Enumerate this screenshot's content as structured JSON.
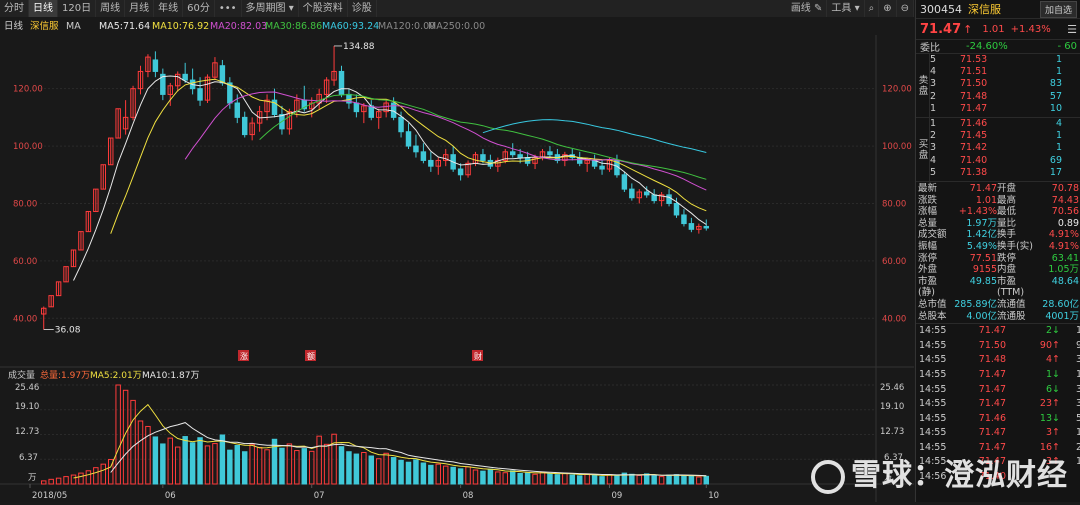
{
  "toolbar": {
    "tabs": [
      "分时",
      "日线",
      "120日",
      "周线",
      "月线",
      "年线",
      "60分"
    ],
    "active_tab": 1,
    "more": "•••",
    "multi_period": "多周期图",
    "stock_info": "个股资料",
    "diagnosis": "诊股",
    "draw": "画线",
    "tools": "工具"
  },
  "chart_header": {
    "period": "日线",
    "stock": "深信服",
    "ma_label": "MA",
    "ma5": "MA5:71.64",
    "ma10": "MA10:76.92",
    "ma20": "MA20:82.03",
    "ma30": "MA30:86.86",
    "ma60": "MA60:93.24",
    "ma120": "MA120:0.00",
    "ma250": "MA250:0.00"
  },
  "colors": {
    "ma5": "#e8e8e8",
    "ma10": "#f0e040",
    "ma20": "#d050d0",
    "ma30": "#40c040",
    "ma60": "#38c8e0",
    "up": "#ff3b3b",
    "down": "#40c8d8"
  },
  "annotations": {
    "high": "134.88",
    "low": "36.08",
    "mark1": "涨",
    "mark2": "额",
    "mark3": "财"
  },
  "volume_header": {
    "title": "成交量",
    "total": "总量:1.97万",
    "ma5": "MA5:2.01万",
    "ma10": "MA10:1.87万"
  },
  "volume_axis": {
    "ticks": [
      "25.46",
      "19.10",
      "12.73",
      "6.37"
    ],
    "unit": "万"
  },
  "x_labels": [
    "2018/05",
    "06",
    "07",
    "08",
    "09",
    "10"
  ],
  "chart_data": {
    "type": "candlestick",
    "y_ticks": [
      120,
      100,
      80,
      60,
      40
    ],
    "ylim": [
      30,
      138
    ],
    "x_labels": [
      "2018/05",
      "06",
      "07",
      "08",
      "09",
      "10"
    ],
    "candles": [
      [
        41.5,
        44.1,
        36.08,
        43.5
      ],
      [
        44,
        47.9,
        44,
        47.9
      ],
      [
        47.9,
        52.7,
        47.9,
        52.7
      ],
      [
        52.7,
        58,
        52.7,
        58
      ],
      [
        58,
        63.8,
        58,
        63.8
      ],
      [
        63.8,
        70.2,
        63.8,
        70.2
      ],
      [
        70.2,
        77.2,
        70.2,
        77.2
      ],
      [
        77.2,
        85,
        77.2,
        85
      ],
      [
        85,
        93.5,
        85,
        93.5
      ],
      [
        93.5,
        102.8,
        93.5,
        102.8
      ],
      [
        102.8,
        113,
        102.8,
        113
      ],
      [
        106,
        116,
        104,
        110
      ],
      [
        110,
        121,
        109,
        120
      ],
      [
        120,
        128,
        118,
        126
      ],
      [
        126,
        132,
        124,
        131
      ],
      [
        130,
        133,
        124,
        126
      ],
      [
        125,
        127,
        116,
        118
      ],
      [
        118,
        122,
        114,
        121
      ],
      [
        121,
        126,
        119,
        125
      ],
      [
        125,
        129,
        122,
        123
      ],
      [
        123,
        127,
        118,
        120
      ],
      [
        120,
        124,
        114,
        116
      ],
      [
        116,
        125,
        115,
        124
      ],
      [
        124,
        131,
        123,
        129
      ],
      [
        128,
        130,
        121,
        122
      ],
      [
        122,
        124,
        113,
        115
      ],
      [
        115,
        118,
        108,
        110
      ],
      [
        110,
        112,
        103,
        104
      ],
      [
        104,
        110,
        102,
        108
      ],
      [
        108,
        114,
        105,
        112
      ],
      [
        112,
        118,
        109,
        116
      ],
      [
        116,
        120,
        110,
        111
      ],
      [
        111,
        114,
        104,
        106
      ],
      [
        106,
        113,
        104,
        112
      ],
      [
        112,
        118,
        110,
        116
      ],
      [
        116,
        121,
        112,
        113
      ],
      [
        113,
        117,
        110,
        115
      ],
      [
        115,
        120,
        113,
        118
      ],
      [
        118,
        124,
        115,
        123
      ],
      [
        123,
        134.88,
        121,
        126
      ],
      [
        126,
        128,
        117,
        118
      ],
      [
        118,
        120,
        113,
        115
      ],
      [
        115,
        118,
        110,
        112
      ],
      [
        112,
        115,
        108,
        114
      ],
      [
        114,
        116,
        109,
        110
      ],
      [
        110,
        113,
        106,
        112
      ],
      [
        112,
        116,
        110,
        115
      ],
      [
        115,
        117,
        109,
        110
      ],
      [
        110,
        112,
        103,
        105
      ],
      [
        105,
        108,
        99,
        100
      ],
      [
        100,
        104,
        96,
        98
      ],
      [
        98,
        101,
        94,
        95
      ],
      [
        95,
        98,
        91,
        93
      ],
      [
        93,
        96,
        90,
        95
      ],
      [
        95,
        99,
        93,
        97
      ],
      [
        97,
        100,
        91,
        92
      ],
      [
        92,
        94,
        88,
        90
      ],
      [
        90,
        95,
        89,
        94
      ],
      [
        94,
        98,
        93,
        97
      ],
      [
        97,
        99,
        94,
        95
      ],
      [
        95,
        97,
        92,
        93
      ],
      [
        93,
        96,
        91,
        95
      ],
      [
        95,
        99,
        94,
        98
      ],
      [
        98,
        101,
        96,
        97
      ],
      [
        97,
        99,
        94,
        96
      ],
      [
        96,
        98,
        93,
        94
      ],
      [
        94,
        97,
        92,
        96
      ],
      [
        96,
        99,
        95,
        98
      ],
      [
        98,
        100,
        96,
        97
      ],
      [
        97,
        99,
        94,
        95
      ],
      [
        95,
        98,
        93,
        97
      ],
      [
        97,
        99,
        95,
        96
      ],
      [
        96,
        98,
        93,
        94
      ],
      [
        94,
        96,
        91,
        95
      ],
      [
        95,
        97,
        92,
        93
      ],
      [
        93,
        95,
        90,
        92
      ],
      [
        92,
        96,
        91,
        95
      ],
      [
        95,
        97,
        89,
        90
      ],
      [
        90,
        91,
        84,
        85
      ],
      [
        85,
        87,
        81,
        82
      ],
      [
        82,
        85,
        80,
        84
      ],
      [
        84,
        86,
        82,
        83
      ],
      [
        83,
        85,
        80,
        81
      ],
      [
        81,
        84,
        79,
        83
      ],
      [
        83,
        85,
        79,
        80
      ],
      [
        80,
        82,
        75,
        76
      ],
      [
        76,
        78,
        72,
        73
      ],
      [
        73,
        75,
        70,
        71
      ],
      [
        71,
        73,
        69.5,
        72
      ],
      [
        72,
        74.43,
        70.56,
        71.47
      ]
    ],
    "volume": [
      0.8,
      1.2,
      1.5,
      1.9,
      2.3,
      2.8,
      3.4,
      4.2,
      5.1,
      6.3,
      25.46,
      24.1,
      21.5,
      16.2,
      14.8,
      12.1,
      10.3,
      11.8,
      9.5,
      12.2,
      10.6,
      11.9,
      9.8,
      10.4,
      12.6,
      8.7,
      9.9,
      8.3,
      10.1,
      9.4,
      8.8,
      11.5,
      9.2,
      10.3,
      8.6,
      9.1,
      8.4,
      12.3,
      10.2,
      12.8,
      9.6,
      8.3,
      7.7,
      8.1,
      7.2,
      6.5,
      7.9,
      6.8,
      6.1,
      5.6,
      6.2,
      5.4,
      4.8,
      5.1,
      4.6,
      4.3,
      3.9,
      4.4,
      3.6,
      3.3,
      3.8,
      3.1,
      2.9,
      3.4,
      2.7,
      2.8,
      2.5,
      3.1,
      2.6,
      2.4,
      2.8,
      2.3,
      2.1,
      2.6,
      2.2,
      1.9,
      2.4,
      2.1,
      2.8,
      2.5,
      2.2,
      2.6,
      2.1,
      1.9,
      2.3,
      2.4,
      2.2,
      2.0,
      1.8,
      1.97
    ]
  },
  "panel": {
    "code": "300454",
    "name": "深信服",
    "add_button": "加自选",
    "price": "71.47",
    "change": "1.01",
    "change_pct": "+1.43%",
    "weibi_label": "委比",
    "weibi_value": "-24.60%",
    "weibi_diff": "- 60",
    "sell_label": "卖盘",
    "buy_label": "买盘",
    "sell": [
      {
        "lv": "5",
        "px": "71.53",
        "vol": "1"
      },
      {
        "lv": "4",
        "px": "71.51",
        "vol": "1"
      },
      {
        "lv": "3",
        "px": "71.50",
        "vol": "83"
      },
      {
        "lv": "2",
        "px": "71.48",
        "vol": "57"
      },
      {
        "lv": "1",
        "px": "71.47",
        "vol": "10"
      }
    ],
    "buy": [
      {
        "lv": "1",
        "px": "71.46",
        "vol": "4"
      },
      {
        "lv": "2",
        "px": "71.45",
        "vol": "1"
      },
      {
        "lv": "3",
        "px": "71.42",
        "vol": "1"
      },
      {
        "lv": "4",
        "px": "71.40",
        "vol": "69"
      },
      {
        "lv": "5",
        "px": "71.38",
        "vol": "17"
      }
    ],
    "stats": [
      [
        "最新",
        "71.47",
        "开盘",
        "70.78"
      ],
      [
        "涨跌",
        "1.01",
        "最高",
        "74.43"
      ],
      [
        "涨幅",
        "+1.43%",
        "最低",
        "70.56"
      ],
      [
        "总量",
        "1.97万",
        "量比",
        "0.89"
      ],
      [
        "成交额",
        "1.42亿",
        "换手",
        "4.91%"
      ],
      [
        "振幅",
        "5.49%",
        "换手(实)",
        "4.91%"
      ],
      [
        "涨停",
        "77.51",
        "跌停",
        "63.41"
      ],
      [
        "外盘",
        "9155",
        "内盘",
        "1.05万"
      ],
      [
        "市盈(静)",
        "49.85",
        "市盈(TTM)",
        "48.64"
      ],
      [
        "总市值",
        "285.89亿",
        "流通值",
        "28.60亿"
      ],
      [
        "总股本",
        "4.00亿",
        "流通股",
        "4001万"
      ]
    ],
    "ticks": [
      {
        "t": "14:55",
        "p": "71.47",
        "q": "2",
        "d": "down",
        "n": "1"
      },
      {
        "t": "14:55",
        "p": "71.50",
        "q": "90",
        "d": "up",
        "n": "9"
      },
      {
        "t": "14:55",
        "p": "71.48",
        "q": "4",
        "d": "up",
        "n": "3"
      },
      {
        "t": "14:55",
        "p": "71.47",
        "q": "1",
        "d": "down",
        "n": "1"
      },
      {
        "t": "14:55",
        "p": "71.47",
        "q": "6",
        "d": "down",
        "n": "3"
      },
      {
        "t": "14:55",
        "p": "71.47",
        "q": "23",
        "d": "up",
        "n": "3"
      },
      {
        "t": "14:55",
        "p": "71.46",
        "q": "13",
        "d": "down",
        "n": "5"
      },
      {
        "t": "14:55",
        "p": "71.47",
        "q": "3",
        "d": "up",
        "n": "1"
      },
      {
        "t": "14:55",
        "p": "71.47",
        "q": "16",
        "d": "up",
        "n": "2"
      },
      {
        "t": "14:55",
        "p": "71.47",
        "q": "3",
        "d": "up",
        "n": "1"
      },
      {
        "t": "14:56",
        "p": "71.40",
        "q": "",
        "d": "",
        "n": ""
      }
    ]
  },
  "watermark": {
    "text": "雪球：澄泓财经"
  }
}
